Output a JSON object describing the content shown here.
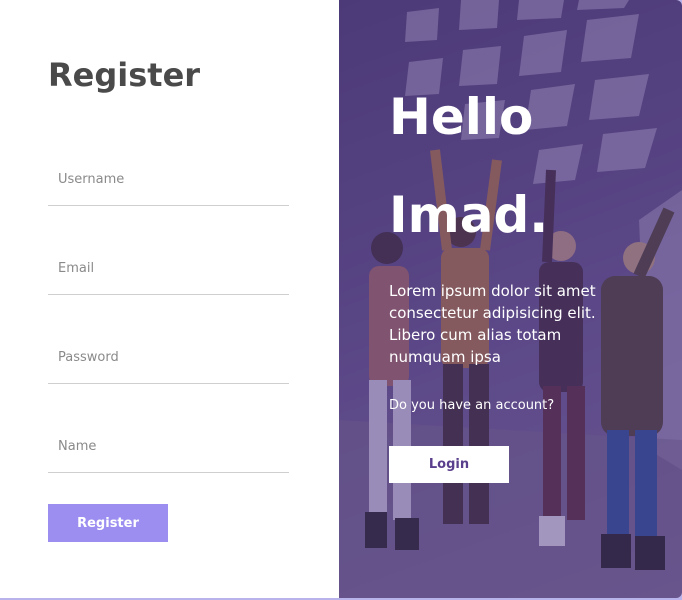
{
  "register": {
    "title": "Register",
    "fields": {
      "username_placeholder": "Username",
      "email_placeholder": "Email",
      "password_placeholder": "Password",
      "name_placeholder": "Name"
    },
    "button_label": "Register"
  },
  "welcome": {
    "line1": "Hello",
    "line2": "Imad.",
    "description": "Lorem ipsum dolor sit amet consectetur adipisicing elit. Libero cum alias totam numquam ipsa",
    "question": "Do you have an account?",
    "login_label": "Login"
  },
  "colors": {
    "accent": "#9b8ef0",
    "overlay": "#503782",
    "title_text": "#4a4a4a",
    "login_text": "#5a3f8c"
  }
}
